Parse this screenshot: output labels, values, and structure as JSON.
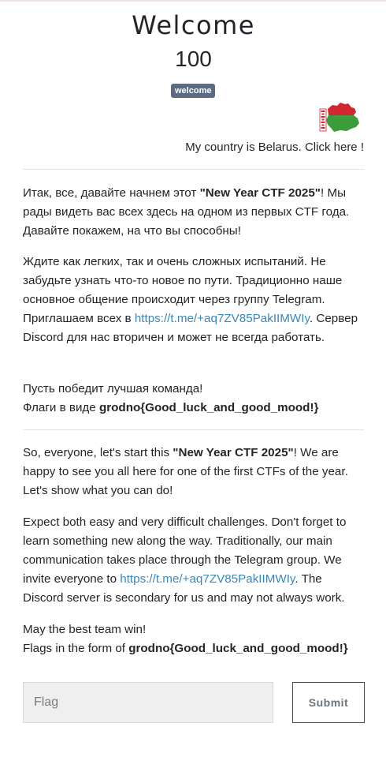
{
  "challenge": {
    "title": "Welcome",
    "points": "100",
    "tag": "welcome"
  },
  "country": {
    "link_text": "My country is Belarus. Click here !",
    "flag_icon": "belarus-map-flag-icon",
    "colors": {
      "red": "#d22730",
      "green": "#3c9b3a",
      "white": "#ffffff"
    }
  },
  "ru": {
    "p1": {
      "a": "Итак, все, давайте начнем этот ",
      "bold": "\"New Year CTF 2025\"",
      "b": "! Мы рады видеть вас всех здесь на одном из первых CTF года. Давайте покажем, на что вы способны!"
    },
    "p2": {
      "a": "Ждите как легких, так и очень сложных испытаний. Не забудьте узнать что-то новое по пути. Традиционно наше основное общение происходит через группу Telegram. Приглашаем всех в ",
      "link": "https://t.me/+aq7ZV85PakIIMWIy",
      "b": ". Сервер Discord для нас вторичен и может не всегда работать."
    },
    "p3": {
      "line1": "Пусть победит лучшая команда!",
      "line2_a": "Флаги в виде ",
      "line2_bold": "grodno{Good_luck_and_good_mood!}"
    }
  },
  "en": {
    "p1": {
      "a": "So, everyone, let's start this ",
      "bold": "\"New Year CTF 2025\"",
      "b": "! We are happy to see you all here for one of the first CTFs of the year. Let's show what you can do!"
    },
    "p2": {
      "a": "Expect both easy and very difficult challenges. Don't forget to learn something new along the way. Traditionally, our main communication takes place through the Telegram group. We invite everyone to ",
      "link": "https://t.me/+aq7ZV85PakIIMWIy",
      "b": ". The Discord server is secondary for us and may not always work."
    },
    "p3": {
      "line1": "May the best team win!",
      "line2_a": "Flags in the form of ",
      "line2_bold": "grodno{Good_luck_and_good_mood!}"
    }
  },
  "form": {
    "placeholder": "Flag",
    "value": "",
    "submit_label": "Submit"
  },
  "theme": {
    "link_color": "#3a87b8",
    "badge_color": "#5b6c82"
  }
}
